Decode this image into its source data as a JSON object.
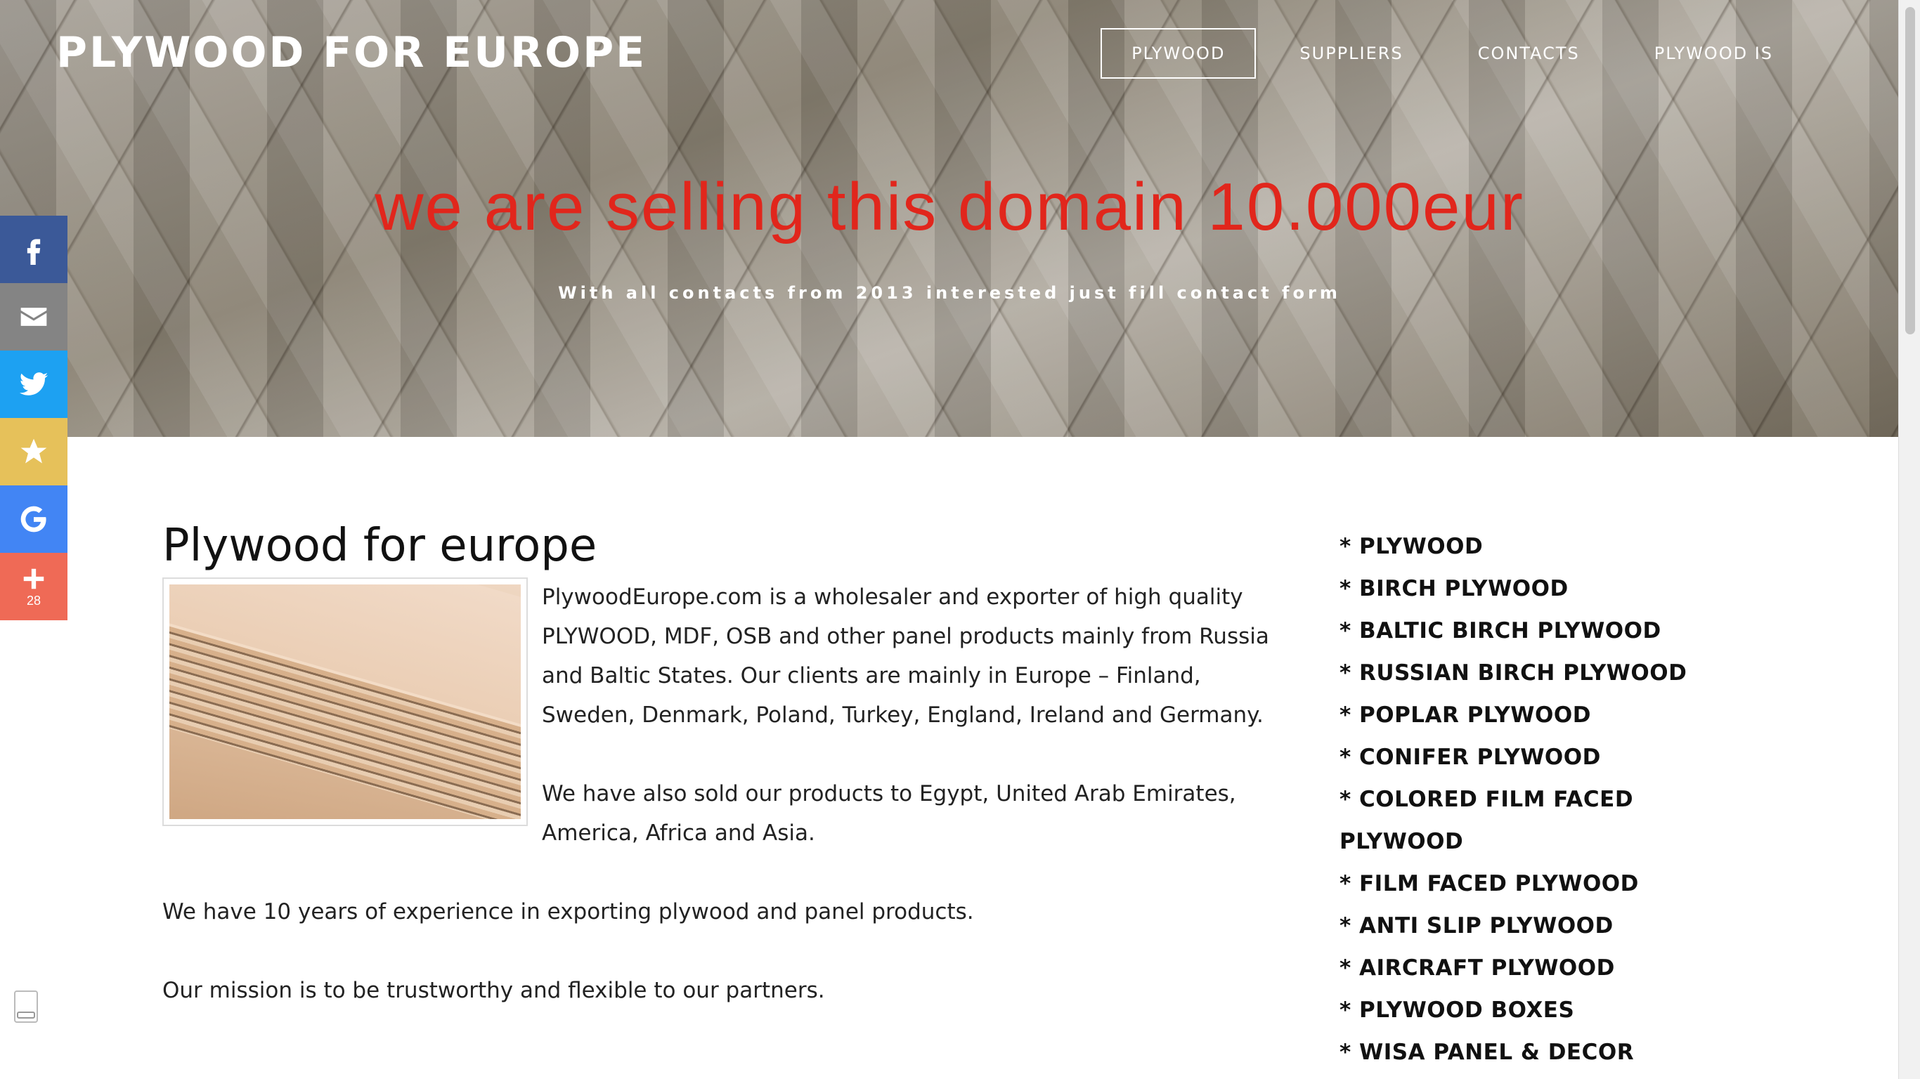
{
  "header": {
    "brand": "PLYWOOD FOR EUROPE",
    "nav": [
      {
        "label": "PLYWOOD",
        "active": true
      },
      {
        "label": "SUPPLIERS"
      },
      {
        "label": "CONTACTS"
      },
      {
        "label": "PLYWOOD IS"
      }
    ]
  },
  "hero": {
    "title": "we are selling this domain 10.000eur",
    "subtitle": "With all contacts from 2013 interested just fill contact form",
    "title_color": "#e1261c"
  },
  "share": {
    "buttons": [
      {
        "icon": "facebook-icon",
        "color": "#3b5998"
      },
      {
        "icon": "email-icon",
        "color": "#848484"
      },
      {
        "icon": "twitter-icon",
        "color": "#1da1f2"
      },
      {
        "icon": "star-icon",
        "color": "#e6c15a"
      },
      {
        "icon": "google-icon",
        "color": "#4285f4"
      },
      {
        "icon": "plus-icon",
        "color": "#ef6a56",
        "count": "28"
      }
    ]
  },
  "main": {
    "title": "Plywood for europe",
    "paragraphs": [
      "PlywoodEurope.com is a wholesaler and exporter of high quality PLYWOOD, MDF, OSB and other panel products mainly from Russia and Baltic States. Our clients are mainly in Europe – Finland, Sweden, Denmark, Poland, Turkey, England, Ireland and Germany.",
      "We have also sold our products to Egypt, United Arab Emirates, America, Africa and Asia.",
      "We have 10 years of experience in exporting plywood and panel products.",
      "Our mission is to be trustworthy and flexible to our partners."
    ]
  },
  "sidebar": {
    "items": [
      "* PLYWOOD",
      "* BIRCH PLYWOOD",
      "* BALTIC BIRCH PLYWOOD",
      "* RUSSIAN BIRCH PLYWOOD",
      "* POPLAR PLYWOOD",
      "* CONIFER PLYWOOD",
      "* COLORED FILM FACED PLYWOOD",
      "* FILM FACED PLYWOOD",
      "* ANTI SLIP PLYWOOD",
      "* AIRCRAFT PLYWOOD",
      "* PLYWOOD BOXES",
      "* WISA PANEL & DECOR"
    ]
  }
}
